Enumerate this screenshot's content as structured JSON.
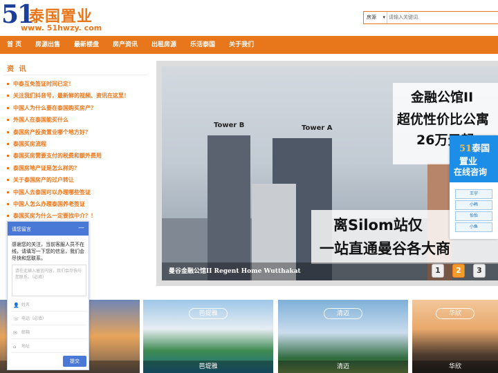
{
  "header": {
    "logo_num": "51",
    "logo_cn": "泰国置业",
    "logo_url": "www. 51hwzy. com",
    "search_select": "房源",
    "search_placeholder": "请输入关键词."
  },
  "nav": [
    "首  页",
    "房源出售",
    "最新楼盘",
    "房产资讯",
    "出租房源",
    "乐活泰国",
    "关于我们"
  ],
  "news": {
    "title": "资 讯",
    "items": [
      "中泰互免签证时间已定！",
      "关注我们抖音号，最新鲜的视频、资讯在这里！",
      "中国人为什么要在泰国购买房产？",
      "外国人在泰国能买什么",
      "泰国房产投资置业哪个地方好？",
      "泰国买房流程",
      "泰国买房需要支付的税费和额外费用",
      "泰国房地产证是怎么样的？",
      "关于泰国房产的过户转让",
      "中国人去泰国可以办理哪些签证",
      "中国人怎么办理泰国养老签证",
      "泰国买房为什么一定要找中介？！"
    ]
  },
  "banner": {
    "tower_b": "Tower B",
    "tower_a": "Tower A",
    "headline_1": "金融公馆II",
    "headline_2": "超优性价比公寓",
    "headline_3": "26万元起",
    "lower_1": "离Silom站仅",
    "lower_2": "一站直通曼谷各大商",
    "caption": "曼谷金融公馆II Regent Home Wutthakat",
    "pages": [
      "1",
      "2",
      "3"
    ]
  },
  "consult": {
    "logo_num": "51",
    "logo_cn": "泰国置业",
    "label": "在线咨询",
    "agents": [
      "王宇",
      "小韩",
      "怡怡",
      "小鱼"
    ]
  },
  "chat": {
    "title": "请您留言",
    "minimize": "—",
    "message": "感谢您的关注，当前客服人员不在线，请填写一下您的信息，我们会尽快和您联系。",
    "textarea_placeholder": "请在此输入留言内容，我们会尽快与您联系。（必填）",
    "fields": [
      "姓名",
      "电话（必填）",
      "邮箱",
      "地址"
    ],
    "submit": "提交"
  },
  "cards": [
    {
      "badge": "",
      "name": ""
    },
    {
      "badge": "芭提雅",
      "name": "芭堤雅"
    },
    {
      "badge": "清迈",
      "name": "清迈"
    },
    {
      "badge": "华欣",
      "name": "华欣"
    }
  ]
}
